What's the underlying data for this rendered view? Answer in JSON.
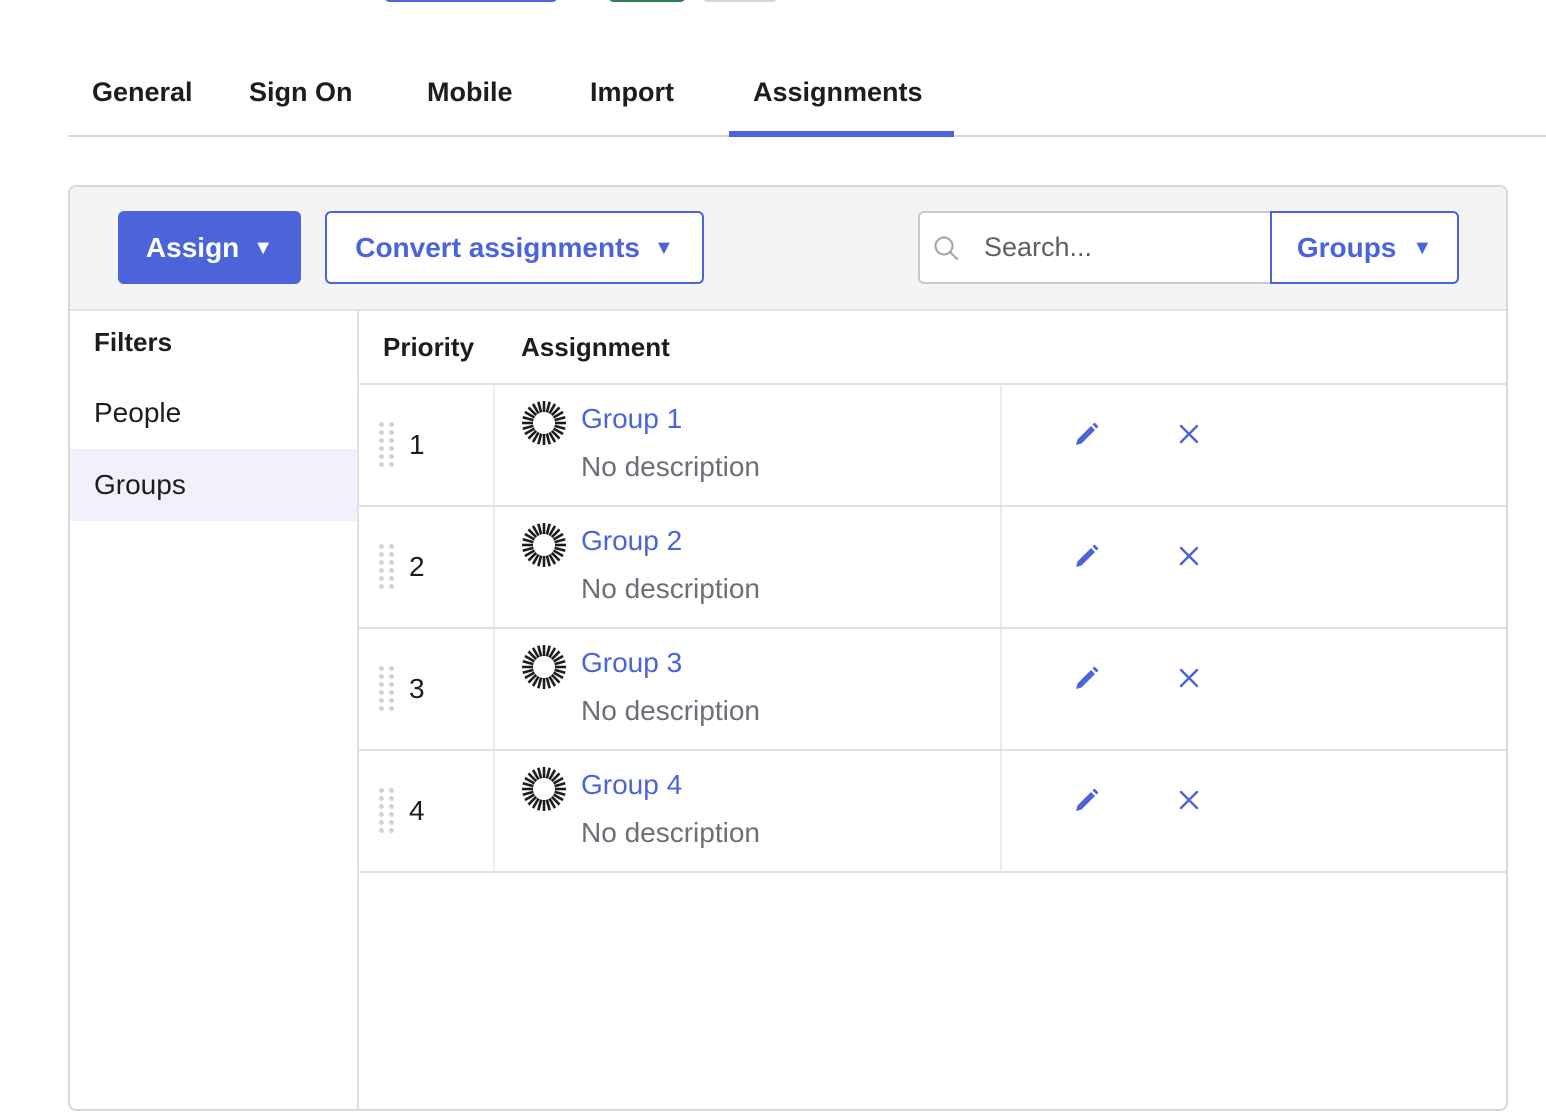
{
  "tabs": [
    {
      "label": "General"
    },
    {
      "label": "Sign On"
    },
    {
      "label": "Mobile"
    },
    {
      "label": "Import"
    },
    {
      "label": "Assignments"
    }
  ],
  "active_tab": "Assignments",
  "toolbar": {
    "assign_label": "Assign",
    "convert_label": "Convert assignments",
    "search_placeholder": "Search...",
    "groups_label": "Groups"
  },
  "filters": {
    "title": "Filters",
    "items": [
      {
        "label": "People"
      },
      {
        "label": "Groups"
      }
    ],
    "selected": "Groups"
  },
  "table": {
    "headers": {
      "priority": "Priority",
      "assignment": "Assignment"
    },
    "rows": [
      {
        "priority": "1",
        "name": "Group 1",
        "description": "No description"
      },
      {
        "priority": "2",
        "name": "Group 2",
        "description": "No description"
      },
      {
        "priority": "3",
        "name": "Group 3",
        "description": "No description"
      },
      {
        "priority": "4",
        "name": "Group 4",
        "description": "No description"
      }
    ]
  },
  "icons": {
    "dropdown": "caret-down-icon",
    "search": "search-icon",
    "drag": "drag-handle-icon",
    "group": "group-icon",
    "edit": "pencil-icon",
    "remove": "close-icon"
  },
  "colors": {
    "accent": "#4c64d9",
    "selected_filter_bg": "#f0f1fb",
    "muted_text": "#6e6e78"
  }
}
